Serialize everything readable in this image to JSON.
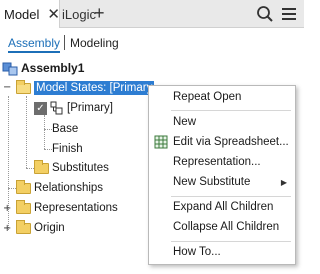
{
  "tabs": [
    {
      "label": "Model"
    },
    {
      "label": "iLogic"
    }
  ],
  "subtabs": {
    "assembly": "Assembly",
    "modeling": "Modeling"
  },
  "tree": {
    "root": "Assembly1",
    "model_states": "Model States: [Primary",
    "primary": "[Primary]",
    "base": "Base",
    "finish": "Finish",
    "substitutes": "Substitutes",
    "relationships": "Relationships",
    "representations": "Representations",
    "origin": "Origin"
  },
  "context_menu": {
    "repeat_open": "Repeat Open",
    "new": "New",
    "edit_spreadsheet": "Edit via Spreadsheet...",
    "representation": "Representation...",
    "new_substitute": "New Substitute",
    "expand_all": "Expand All Children",
    "collapse_all": "Collapse All Children",
    "how_to": "How To..."
  },
  "colors": {
    "accent": "#1c6fb8",
    "selection": "#2d7dd2",
    "folder": "#f3cf63"
  }
}
